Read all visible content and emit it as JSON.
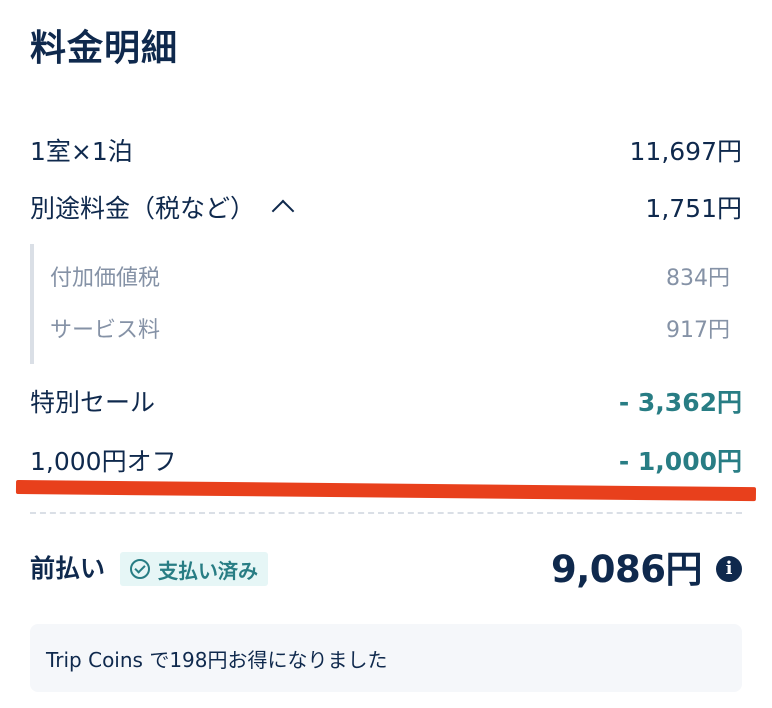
{
  "title": "料金明細",
  "items": {
    "room": {
      "label": "1室×1泊",
      "value": "11,697円"
    },
    "tax": {
      "label": "別途料金（税など）",
      "value": "1,751円"
    },
    "tax_details": [
      {
        "label": "付加価値税",
        "value": "834円"
      },
      {
        "label": "サービス料",
        "value": "917円"
      }
    ],
    "sale": {
      "label": "特別セール",
      "value": "- 3,362円"
    },
    "coupon": {
      "label": "1,000円オフ",
      "value": "- 1,000円"
    }
  },
  "prepay": {
    "label": "前払い",
    "badge": "支払い済み",
    "total": "9,086円",
    "info_glyph": "i"
  },
  "coins_message": "Trip Coins で198円お得になりました",
  "colors": {
    "text": "#0f294d",
    "muted": "#8592a6",
    "discount": "#287d84",
    "annotation_red": "#e8401c",
    "badge_bg": "#e6f6f6"
  }
}
